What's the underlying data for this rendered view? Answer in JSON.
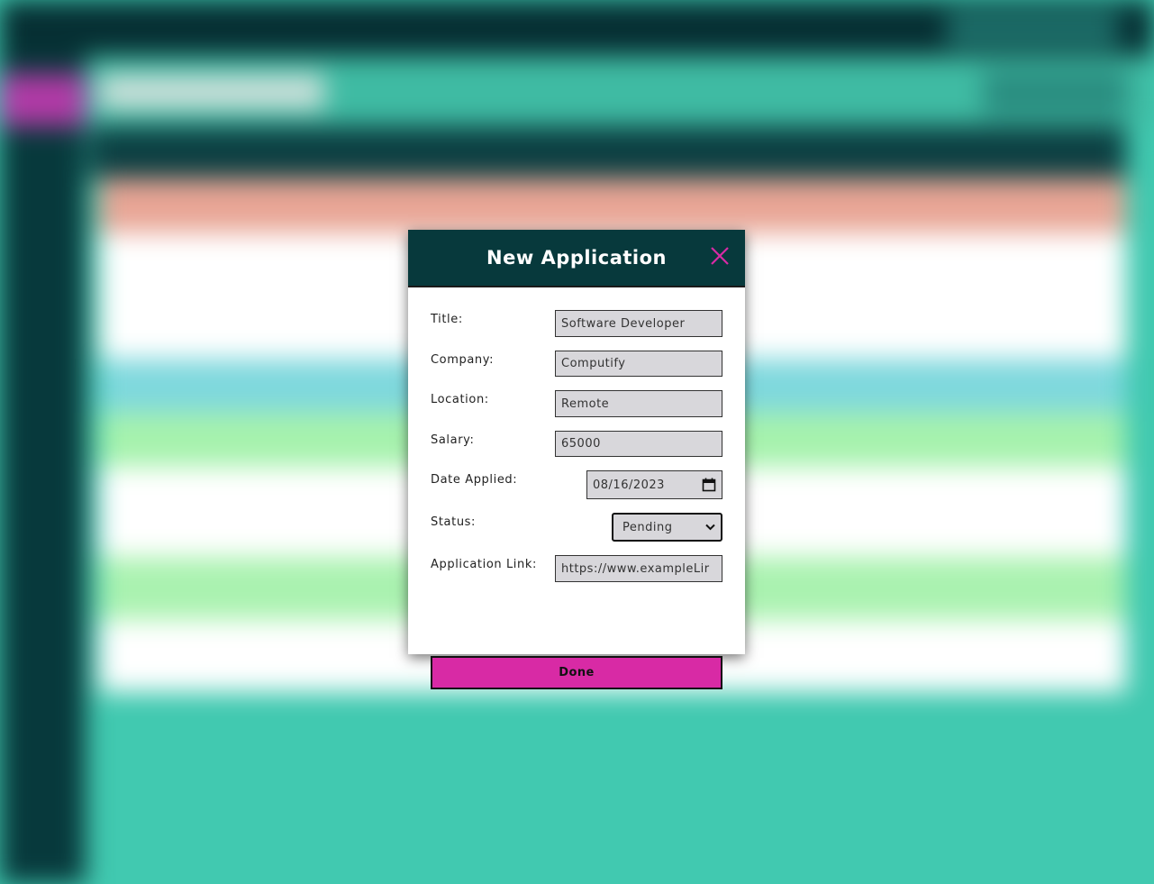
{
  "modal": {
    "title": "New Application",
    "fields": {
      "title": {
        "label": "Title:",
        "value": "Software Developer"
      },
      "company": {
        "label": "Company:",
        "value": "Computify"
      },
      "location": {
        "label": "Location:",
        "value": "Remote"
      },
      "salary": {
        "label": "Salary:",
        "value": "65000"
      },
      "date_applied": {
        "label": "Date Applied:",
        "value": "08/16/2023"
      },
      "status": {
        "label": "Status:",
        "value": "Pending"
      },
      "application_link": {
        "label": "Application Link:",
        "value": "https://www.exampleLir"
      }
    },
    "done_label": "Done"
  },
  "colors": {
    "header_bg": "#07393c",
    "accent": "#d82aa5",
    "close_icon": "#d82aa5",
    "field_bg": "#d8d7db",
    "page_bg": "#41c9b0"
  },
  "icons": {
    "close": "close-icon",
    "calendar": "calendar-icon",
    "dropdown": "chevron-down-icon"
  }
}
